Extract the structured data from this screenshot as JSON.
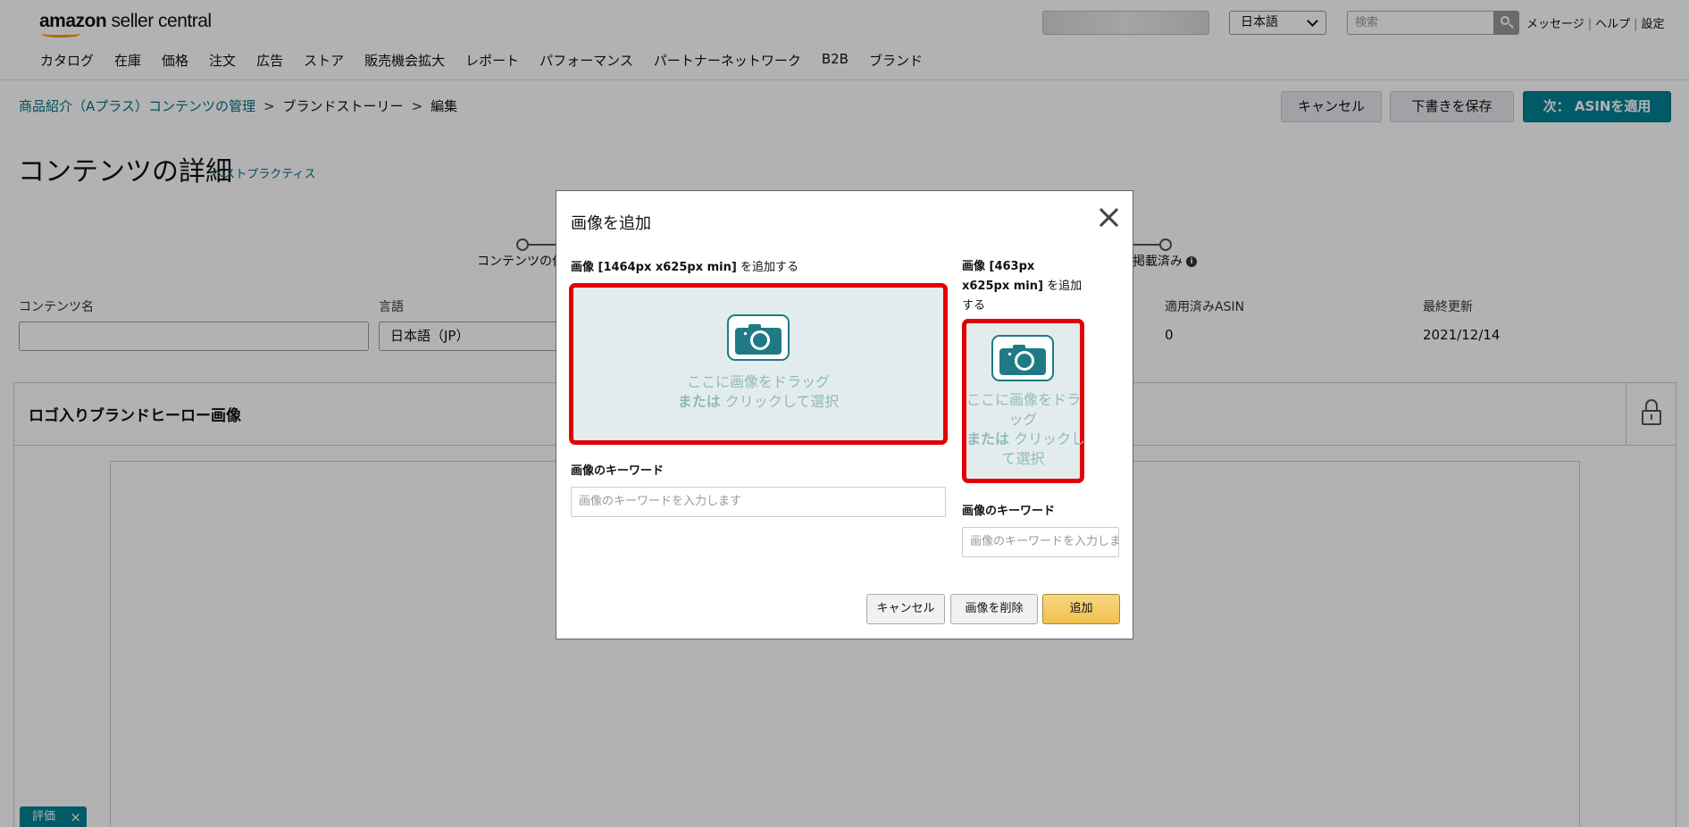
{
  "header": {
    "logo_bold": "amazon",
    "logo_thin": " seller central",
    "language": "日本語",
    "search_placeholder": "検索",
    "links": [
      "メッセージ",
      "ヘルプ",
      "設定"
    ]
  },
  "nav": [
    "カタログ",
    "在庫",
    "価格",
    "注文",
    "広告",
    "ストア",
    "販売機会拡大",
    "レポート",
    "パフォーマンス",
    "パートナーネットワーク",
    "B2B",
    "ブランド"
  ],
  "breadcrumb": {
    "root": "商品紹介（Aプラス）コンテンツの管理",
    "middle": "ブランドストーリー",
    "current": "編集"
  },
  "actions": {
    "cancel": "キャンセル",
    "save_draft": "下書きを保存",
    "next": "次： ASINを適用"
  },
  "page": {
    "title": "コンテンツの詳細",
    "best_practice": "ベストプラクティス"
  },
  "progress": {
    "first": "コンテンツの作",
    "last": "掲載済み"
  },
  "fields": {
    "name_label": "コンテンツ名",
    "name_value": "",
    "language_label": "言語",
    "language_value": "日本語（JP）",
    "asin_label": "適用済みASIN",
    "asin_value": "0",
    "updated_label": "最終更新",
    "updated_value": "2021/12/14"
  },
  "module": {
    "title": "ロゴ入りブランドヒーロー画像"
  },
  "feedback": {
    "label": "評価"
  },
  "modal": {
    "title": "画像を追加",
    "left": {
      "label_bold": "画像 [1464px x625px min]",
      "label_normal": " を追加する",
      "drop_line1": "ここに画像をドラッグ",
      "drop_or": "または",
      "drop_line2": " クリックして選択",
      "keyword_label": "画像のキーワード",
      "keyword_placeholder": "画像のキーワードを入力します"
    },
    "right": {
      "label_line1": "画像 [463px",
      "label_line2_bold": "x625px min]",
      "label_line2_normal": " を追加",
      "label_line3": "する",
      "drop_line1": "ここに画像をドラ",
      "drop_line2": "ッグ",
      "drop_or": "または",
      "drop_line3": " クリックし",
      "drop_line4": "て選択",
      "keyword_label": "画像のキーワード",
      "keyword_placeholder": "画像のキーワードを入力しま"
    },
    "buttons": {
      "cancel": "キャンセル",
      "delete": "画像を削除",
      "add": "追加"
    }
  },
  "colors": {
    "teal": "#008296",
    "link": "#007185",
    "highlight_red": "#e20000",
    "add_button": "#f0c14b"
  }
}
